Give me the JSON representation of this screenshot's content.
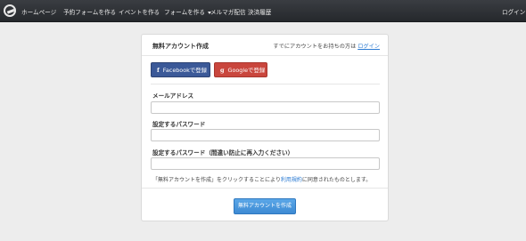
{
  "nav": {
    "items": [
      "ホームページ",
      "予約フォームを作る",
      "イベントを作る",
      "フォームを作る",
      "メルマガ配信",
      "決済履歴"
    ],
    "login": "ログイン"
  },
  "card": {
    "title": "無料アカウント作成",
    "have_account_text": "すでにアカウントをお持ちの方は",
    "login_link": "ログイン",
    "facebook_icon": "f",
    "facebook_label": "Facebookで登録",
    "google_icon": "g",
    "google_label": "Googleで登録",
    "email_label": "メールアドレス",
    "email_value": "",
    "password_label": "設定するパスワード",
    "password_value": "",
    "password_confirm_label": "設定するパスワード（間違い防止に再入力ください）",
    "password_confirm_value": "",
    "agree_prefix": "「無料アカウントを作成」をクリックすることにより",
    "agree_link": "利用規約",
    "agree_suffix": "に同意されたものとします。",
    "submit_label": "無料アカウントを作成"
  },
  "colors": {
    "navbar": "#2c2f33",
    "facebook": "#3b5998",
    "google": "#c9463d",
    "primary": "#3d8ad3",
    "link": "#2a7ad2"
  }
}
